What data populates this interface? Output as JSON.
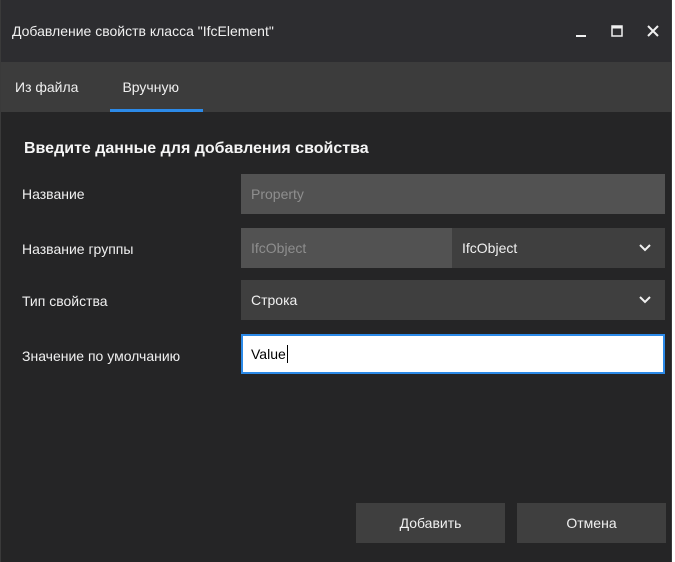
{
  "window": {
    "title": "Добавление свойств класса \"IfcElement\""
  },
  "tabs": [
    {
      "label": "Из файла",
      "active": false
    },
    {
      "label": "Вручную",
      "active": true
    }
  ],
  "form": {
    "section_title": "Введите данные для добавления свойства",
    "name": {
      "label": "Название",
      "value": "Property"
    },
    "group": {
      "label": "Название группы",
      "value": "IfcObject",
      "selected": "IfcObject"
    },
    "type": {
      "label": "Тип свойства",
      "selected": "Строка"
    },
    "default": {
      "label": "Значение по умолчанию",
      "value": "Value"
    }
  },
  "buttons": {
    "add": "Добавить",
    "cancel": "Отмена"
  },
  "colors": {
    "accent": "#2c8ae8",
    "background": "#252526",
    "tabbar": "#3c3c3c"
  }
}
